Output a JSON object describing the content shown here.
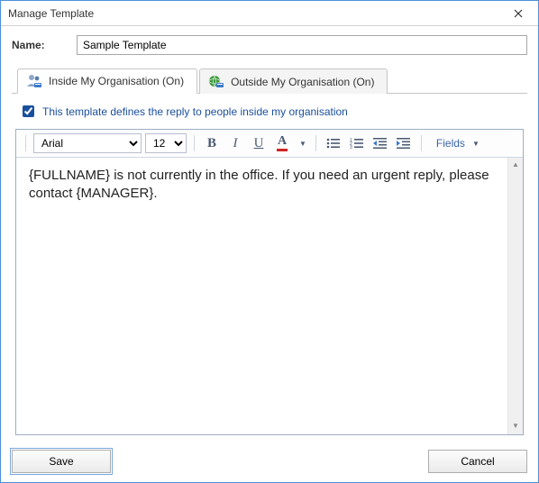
{
  "window": {
    "title": "Manage Template"
  },
  "name": {
    "label": "Name:",
    "value": "Sample Template"
  },
  "tabs": [
    {
      "label": "Inside My Organisation (On)",
      "active": true
    },
    {
      "label": "Outside My Organisation (On)",
      "active": false
    }
  ],
  "checkbox": {
    "label": "This template defines the reply to people inside my organisation",
    "checked": true
  },
  "toolbar": {
    "font": "Arial",
    "size": "12",
    "fields_label": "Fields"
  },
  "editor": {
    "body": "{FULLNAME} is not currently in the office. If you need an urgent reply, please contact {MANAGER}."
  },
  "buttons": {
    "save": "Save",
    "cancel": "Cancel"
  }
}
